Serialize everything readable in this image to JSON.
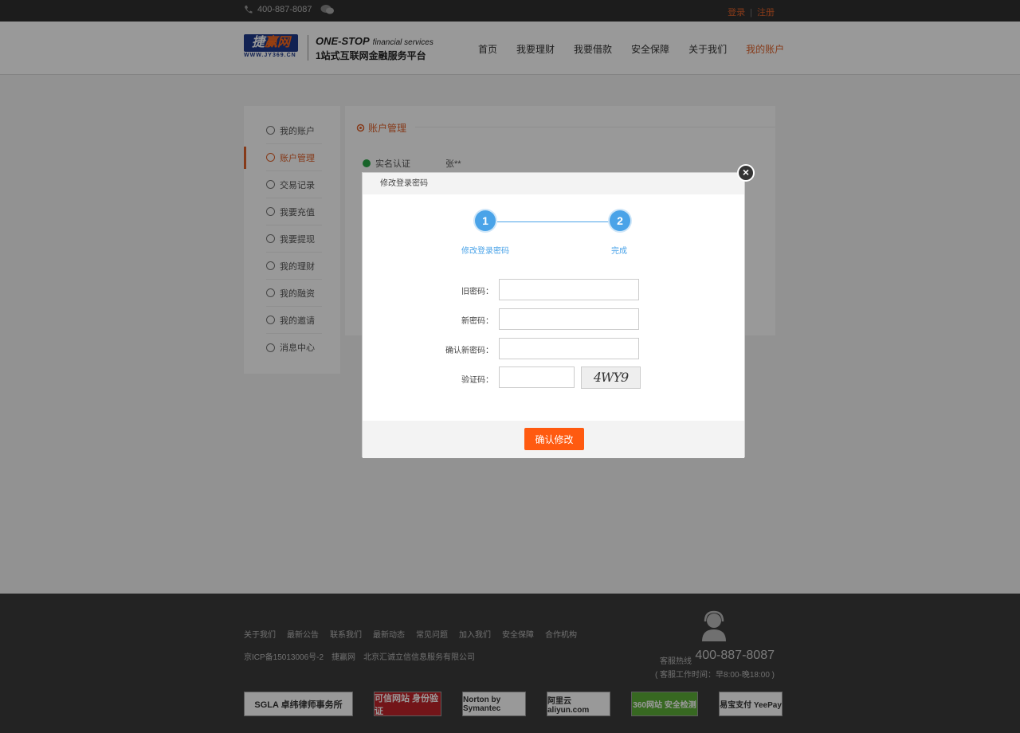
{
  "topbar": {
    "phone": "400-887-8087",
    "login": "登录",
    "register": "注册"
  },
  "logo": {
    "brand_a": "捷",
    "brand_b": "赢网",
    "url": "WWW.JY369.CN"
  },
  "slogan": {
    "en_main": "ONE-STOP",
    "en_sub": "financial services",
    "cn": "1站式互联网金融服务平台"
  },
  "nav": {
    "items": [
      "首页",
      "我要理财",
      "我要借款",
      "安全保障",
      "关于我们",
      "我的账户"
    ],
    "active_index": 5
  },
  "sidebar": {
    "items": [
      {
        "label": "我的账户",
        "icon": "user-icon"
      },
      {
        "label": "账户管理",
        "icon": "gear-icon"
      },
      {
        "label": "交易记录",
        "icon": "list-icon"
      },
      {
        "label": "我要充值",
        "icon": "yen-icon"
      },
      {
        "label": "我要提现",
        "icon": "withdraw-icon"
      },
      {
        "label": "我的理财",
        "icon": "piggy-icon"
      },
      {
        "label": "我的融资",
        "icon": "pie-icon"
      },
      {
        "label": "我的邀请",
        "icon": "invite-icon"
      },
      {
        "label": "消息中心",
        "icon": "mail-icon"
      }
    ],
    "active_index": 1
  },
  "content": {
    "title": "账户管理",
    "realname_label": "实名认证",
    "realname_value": "张**"
  },
  "modal": {
    "title": "修改登录密码",
    "close": "×",
    "steps": [
      {
        "num": "1",
        "label": "修改登录密码"
      },
      {
        "num": "2",
        "label": "完成"
      }
    ],
    "fields": {
      "old": {
        "label": "旧密码：",
        "value": ""
      },
      "new": {
        "label": "新密码：",
        "value": ""
      },
      "confirm": {
        "label": "确认新密码：",
        "value": ""
      },
      "code": {
        "label": "验证码：",
        "value": ""
      }
    },
    "captcha": "4WY9",
    "submit": "确认修改"
  },
  "footer": {
    "links": [
      "关于我们",
      "最新公告",
      "联系我们",
      "最新动态",
      "常见问题",
      "加入我们",
      "安全保障",
      "合作机构"
    ],
    "icp": "京ICP备15013006号-2",
    "site": "捷赢网",
    "company": "北京汇诚立信信息服务有限公司",
    "hotline_label": "客服热线",
    "hotline": "400-887-8087",
    "hours": "( 客服工作时间：早8:00-晚18:00 )",
    "badges": [
      "SGLA 卓纬律师事务所",
      "可信网站 身份验证",
      "Norton by Symantec",
      "阿里云 aliyun.com",
      "360网站 安全检测",
      "易宝支付 YeePay"
    ]
  }
}
